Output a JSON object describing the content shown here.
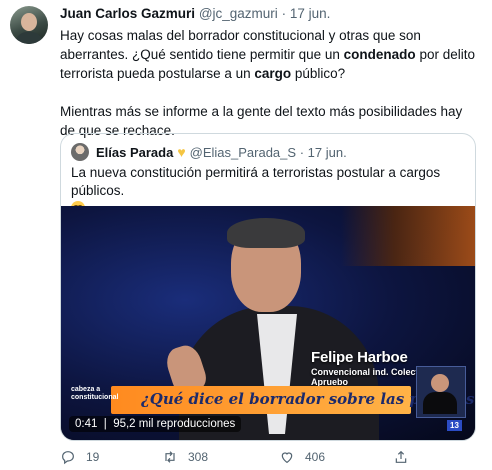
{
  "tweet": {
    "author_name": "Juan Carlos Gazmuri",
    "author_handle": "@jc_gazmuri",
    "separator": "·",
    "date": "17 jun.",
    "text_p1_a": "Hay cosas malas del borrador constitucional y otras que son aberrantes. ¿Qué sentido tiene permitir que un ",
    "text_p1_bold1": "condenado",
    "text_p1_b": " por delito terrorista pueda postularse a un ",
    "text_p1_bold2": "cargo",
    "text_p1_c": " público?",
    "text_p2": "Mientras más se informe a la gente del texto más posibilidades hay de que se rechace."
  },
  "quote": {
    "author_name": "Elías Parada",
    "author_badge": "yellow-heart",
    "author_handle": "@Elias_Parada_S",
    "separator": "·",
    "date": "17 jun.",
    "text": "La nueva constitución permitirá a terroristas postular a cargos públicos."
  },
  "video": {
    "lower_third_name": "Felipe Harboe",
    "lower_third_role": "Convencional ind. Colectivo del Apruebo",
    "banner": "¿Qué dice el borrador sobre las policías?",
    "show_logo_line1": "cabeza a",
    "show_logo_line2": "constitucional",
    "rating_badge": "13",
    "duration": "0:41",
    "views": "95,2 mil reproducciones"
  },
  "actions": {
    "reply_count": "19",
    "retweet_count": "308",
    "like_count": "406"
  },
  "colors": {
    "text": "#0f1419",
    "secondary": "#536471",
    "border": "#cfd9de",
    "banner": "#ff8a1f"
  }
}
